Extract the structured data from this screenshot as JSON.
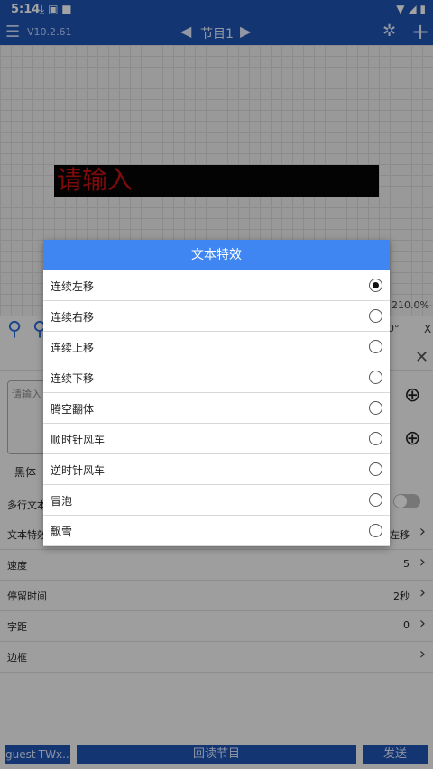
{
  "status": {
    "time": "5:14",
    "icons_left": "⤓ ▣ ■",
    "icons_right": "▼ ◢ ▮"
  },
  "appbar": {
    "version": "V10.2.61",
    "program": "节目1"
  },
  "canvas": {
    "led_text": "请输入",
    "zoom": "210.0%"
  },
  "panel": {
    "text_placeholder": "请输入",
    "font": "黑体",
    "multiline_label": "多行文本",
    "angle": "0°",
    "rows": [
      {
        "label": "文本特效",
        "value": "连续左移"
      },
      {
        "label": "速度",
        "value": "5"
      },
      {
        "label": "停留时间",
        "value": "2秒"
      },
      {
        "label": "字距",
        "value": "0"
      },
      {
        "label": "边框",
        "value": ""
      }
    ]
  },
  "bottom": {
    "device": "guest-TWx...",
    "read_program": "回读节目",
    "send": "发送"
  },
  "dialog": {
    "title": "文本特效",
    "options": [
      {
        "label": "连续左移",
        "selected": true
      },
      {
        "label": "连续右移",
        "selected": false
      },
      {
        "label": "连续上移",
        "selected": false
      },
      {
        "label": "连续下移",
        "selected": false
      },
      {
        "label": "腾空翻体",
        "selected": false
      },
      {
        "label": "顺时针风车",
        "selected": false
      },
      {
        "label": "逆时针风车",
        "selected": false
      },
      {
        "label": "冒泡",
        "selected": false
      },
      {
        "label": "飘雪",
        "selected": false
      }
    ]
  }
}
